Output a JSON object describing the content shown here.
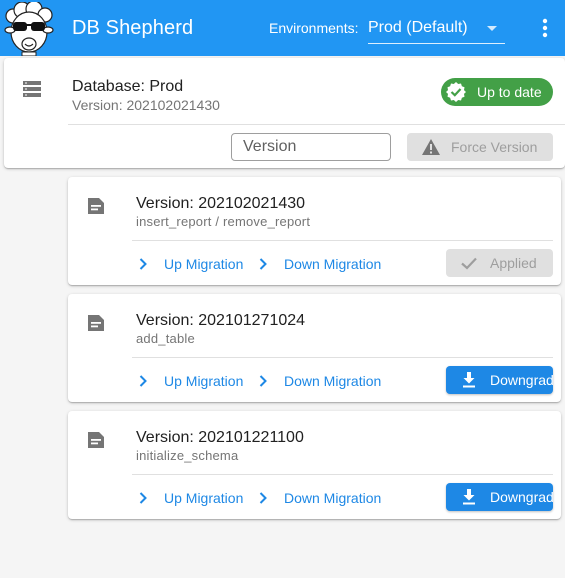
{
  "app": {
    "title": "DB Shepherd",
    "environment_label": "Environments:",
    "environment_value": "Prod (Default)",
    "logo_icon": "sheep-with-sunglasses-icon",
    "more_icon": "more-vert-icon"
  },
  "colors": {
    "primary": "#2196f3",
    "accent_button": "#1e88e5",
    "success": "#43a047",
    "disabled_bg": "#e0e0e0",
    "disabled_text": "#9e9e9e"
  },
  "database": {
    "title": "Database: Prod",
    "version": "Version: 202102021430",
    "status": "Up to date",
    "status_icon": "check-circle-icon",
    "version_input_placeholder": "Version",
    "version_input_value": "",
    "force_label": "Force Version",
    "force_icon": "warning-icon",
    "db_icon": "storage-icon"
  },
  "migrations": [
    {
      "title": "Version: 202102021430",
      "name": "insert_report / remove_report",
      "up_label": "Up Migration",
      "down_label": "Down Migration",
      "action_label": "Applied",
      "action_icon": "check-icon",
      "action_state": "applied"
    },
    {
      "title": "Version: 202101271024",
      "name": "add_table",
      "up_label": "Up Migration",
      "down_label": "Down Migration",
      "action_label": "Downgrade",
      "action_icon": "download-icon",
      "action_state": "downgrade"
    },
    {
      "title": "Version: 202101221100",
      "name": "initialize_schema",
      "up_label": "Up Migration",
      "down_label": "Down Migration",
      "action_label": "Downgrade",
      "action_icon": "download-icon",
      "action_state": "downgrade"
    }
  ]
}
